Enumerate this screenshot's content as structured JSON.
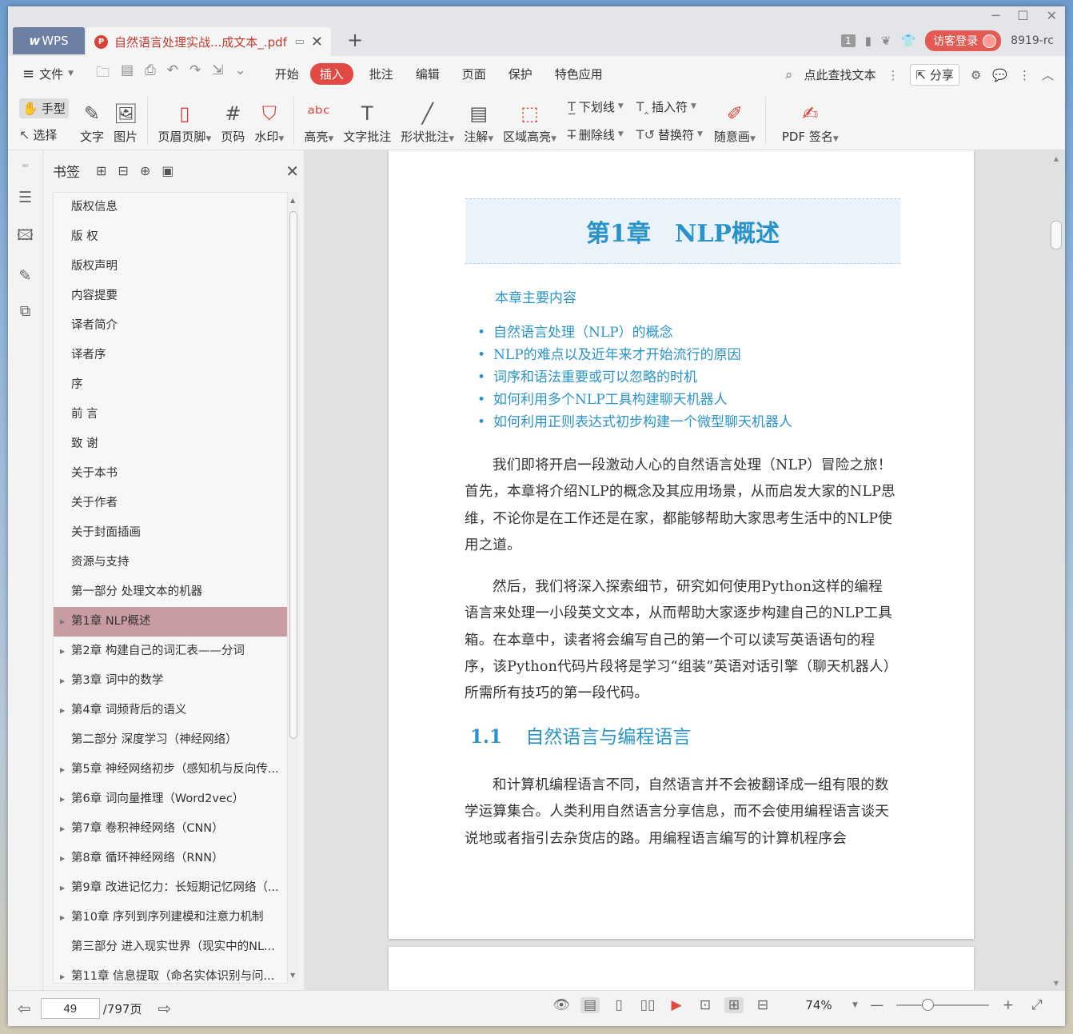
{
  "titlebar": {
    "wps_tab": "WPS",
    "doc_tab_title": "自然语言处理实战...成文本_.pdf",
    "badge_count": "1",
    "login_label": "访客登录",
    "user_id": "8919-rc",
    "new_tab": "+"
  },
  "menubar": {
    "file_label": "文件",
    "tabs": [
      "开始",
      "插入",
      "批注",
      "编辑",
      "页面",
      "保护",
      "特色应用"
    ],
    "active_tab": "插入",
    "search_label": "点此查找文本",
    "share_label": "分享"
  },
  "ribbon": {
    "hand_label": "手型",
    "select_label": "选择",
    "text_label": "文字",
    "image_label": "图片",
    "header_footer_label": "页眉页脚",
    "page_num_label": "页码",
    "watermark_label": "水印",
    "highlight_label": "高亮",
    "text_annot_label": "文字批注",
    "shape_annot_label": "形状批注",
    "note_label": "注解",
    "area_highlight_label": "区域高亮",
    "underline_label": "下划线",
    "strikethrough_label": "删除线",
    "insert_mark_label": "插入符",
    "replace_mark_label": "替换符",
    "freehand_label": "随意画",
    "pdf_sign_label": "PDF 签名"
  },
  "bookmarks": {
    "title": "书签",
    "items": [
      {
        "label": "版权信息",
        "expandable": false,
        "selected": false
      },
      {
        "label": "版 权",
        "expandable": false,
        "selected": false
      },
      {
        "label": "版权声明",
        "expandable": false,
        "selected": false
      },
      {
        "label": "内容提要",
        "expandable": false,
        "selected": false
      },
      {
        "label": "译者简介",
        "expandable": false,
        "selected": false
      },
      {
        "label": "译者序",
        "expandable": false,
        "selected": false
      },
      {
        "label": "序",
        "expandable": false,
        "selected": false
      },
      {
        "label": "前 言",
        "expandable": false,
        "selected": false
      },
      {
        "label": "致 谢",
        "expandable": false,
        "selected": false
      },
      {
        "label": "关于本书",
        "expandable": false,
        "selected": false
      },
      {
        "label": "关于作者",
        "expandable": false,
        "selected": false
      },
      {
        "label": "关于封面插画",
        "expandable": false,
        "selected": false
      },
      {
        "label": "资源与支持",
        "expandable": false,
        "selected": false
      },
      {
        "label": "第一部分 处理文本的机器",
        "expandable": false,
        "selected": false
      },
      {
        "label": "第1章 NLP概述",
        "expandable": true,
        "selected": true
      },
      {
        "label": "第2章 构建自己的词汇表——分词",
        "expandable": true,
        "selected": false
      },
      {
        "label": "第3章 词中的数学",
        "expandable": true,
        "selected": false
      },
      {
        "label": "第4章 词频背后的语义",
        "expandable": true,
        "selected": false
      },
      {
        "label": "第二部分 深度学习（神经网络）",
        "expandable": false,
        "selected": false
      },
      {
        "label": "第5章 神经网络初步（感知机与反向传...",
        "expandable": true,
        "selected": false
      },
      {
        "label": "第6章 词向量推理（Word2vec）",
        "expandable": true,
        "selected": false
      },
      {
        "label": "第7章 卷积神经网络（CNN）",
        "expandable": true,
        "selected": false
      },
      {
        "label": "第8章 循环神经网络（RNN）",
        "expandable": true,
        "selected": false
      },
      {
        "label": "第9章 改进记忆力：长短期记忆网络（...",
        "expandable": true,
        "selected": false
      },
      {
        "label": "第10章 序列到序列建模和注意力机制",
        "expandable": true,
        "selected": false
      },
      {
        "label": "第三部分 进入现实世界（现实中的NL...",
        "expandable": false,
        "selected": false
      },
      {
        "label": "第11章 信息提取（命名实体识别与问...",
        "expandable": true,
        "selected": false
      }
    ]
  },
  "document": {
    "chapter_num": "第1章",
    "chapter_title": "NLP概述",
    "summary_heading": "本章主要内容",
    "summary_items": [
      "自然语言处理（NLP）的概念",
      "NLP的难点以及近年来才开始流行的原因",
      "词序和语法重要或可以忽略的时机",
      "如何利用多个NLP工具构建聊天机器人",
      "如何利用正则表达式初步构建一个微型聊天机器人"
    ],
    "para1": "我们即将开启一段激动人心的自然语言处理（NLP）冒险之旅！首先，本章将介绍NLP的概念及其应用场景，从而启发大家的NLP思维，不论你是在工作还是在家，都能够帮助大家思考生活中的NLP使用之道。",
    "para2": "然后，我们将深入探索细节，研究如何使用Python这样的编程语言来处理一小段英文文本，从而帮助大家逐步构建自己的NLP工具箱。在本章中，读者将会编写自己的第一个可以读写英语语句的程序，该Python代码片段将是学习“组装”英语对话引擎（聊天机器人）所需所有技巧的第一段代码。",
    "section_num": "1.1",
    "section_title": "自然语言与编程语言",
    "para3": "和计算机编程语言不同，自然语言并不会被翻译成一组有限的数学运算集合。人类利用自然语言分享信息，而不会使用编程语言谈天说地或者指引去杂货店的路。用编程语言编写的计算机程序会"
  },
  "statusbar": {
    "current_page": "49",
    "total_pages": "/797页",
    "zoom": "74%"
  },
  "colors": {
    "accent_red": "#e04a42",
    "doc_heading_blue": "#2a93c9",
    "bookmark_selected": "#c89ca2"
  }
}
